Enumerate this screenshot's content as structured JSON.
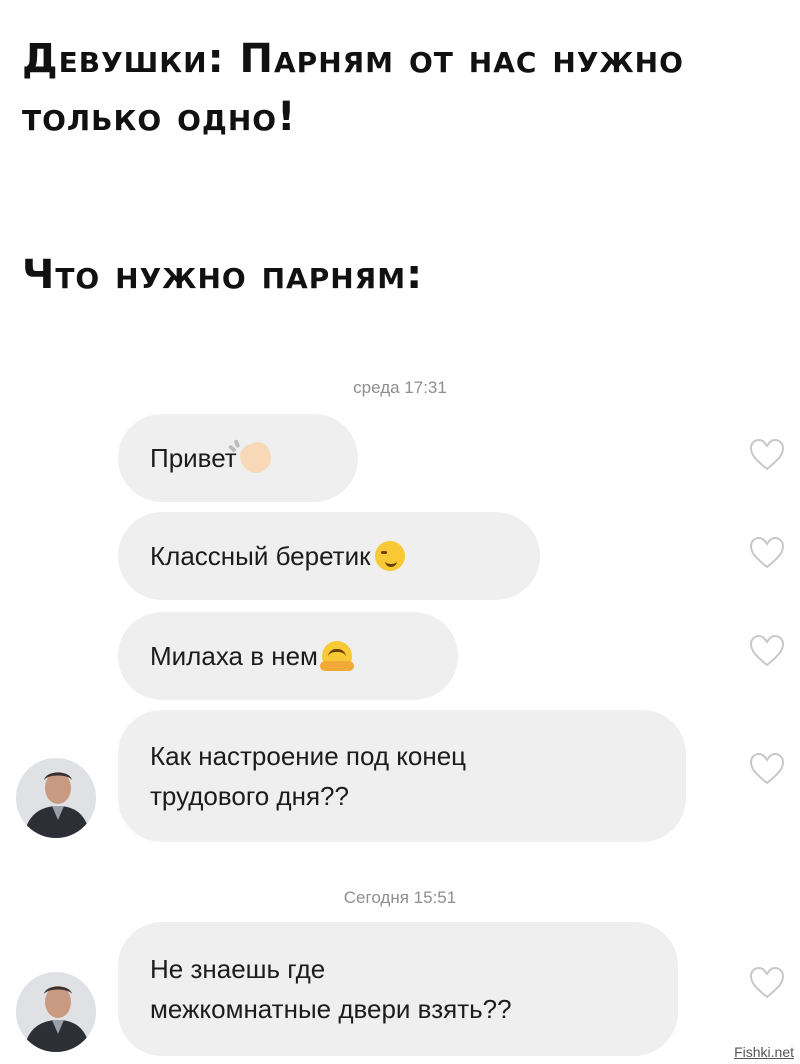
{
  "meme": {
    "caption_line1_word1_cap": "Д",
    "caption_line1_word1_rest": "евушки: ",
    "caption_line1_word2_cap": "П",
    "caption_line1_word2_rest": "арням от нас нужно только одно!",
    "caption_line2_cap": "Ч",
    "caption_line2_rest": "то нужно парням:"
  },
  "chat": {
    "timestamp1": "среда 17:31",
    "messages_block1": [
      {
        "text": "Привет",
        "emoji": "waving-hand"
      },
      {
        "text": "Классный беретик",
        "emoji": "smirking-face"
      },
      {
        "text": "Милаха в нем",
        "emoji": "hugging-face"
      },
      {
        "text": "Как настроение под конец\nтрудового дня??",
        "emoji": ""
      }
    ],
    "timestamp2": "Сегодня 15:51",
    "messages_block2": [
      {
        "text": "Не знаешь где\nмежкомнатные двери взять??",
        "emoji": ""
      }
    ]
  },
  "watermark": "Fishki.net",
  "colors": {
    "bubble": "#efefef",
    "timestamp": "#8e8e8e",
    "heart_outline": "#c8c8c8"
  }
}
